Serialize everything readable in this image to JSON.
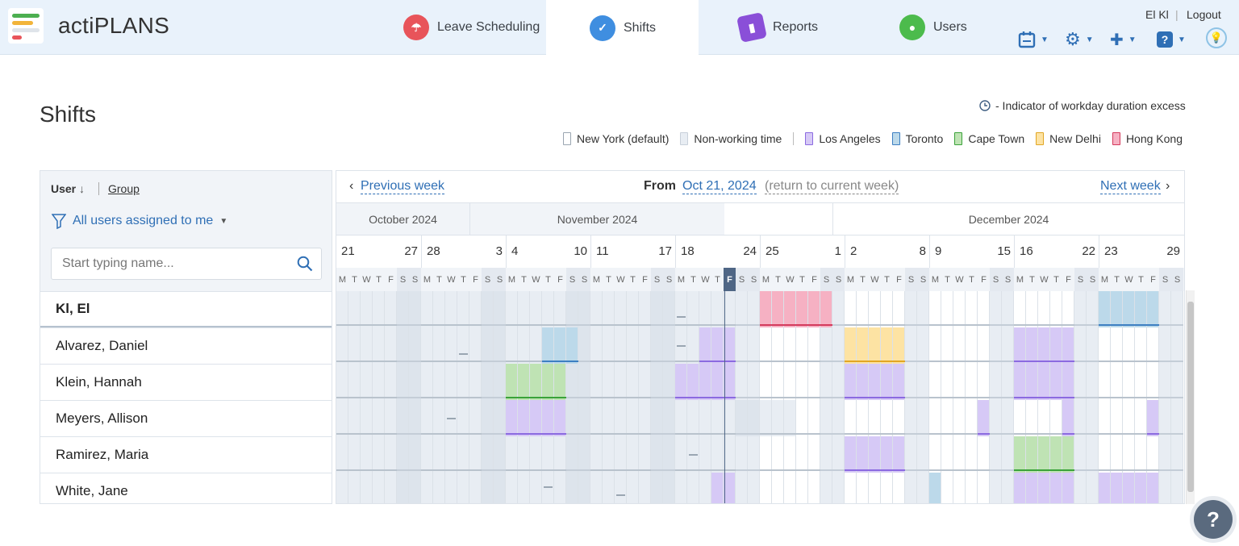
{
  "app": {
    "brand": "actiPLANS"
  },
  "tabs": [
    {
      "label": "Leave Scheduling",
      "icon": "leave-scheduling-icon",
      "color": "#e8545a"
    },
    {
      "label": "Shifts",
      "icon": "shifts-icon",
      "color": "#3f8ee0"
    },
    {
      "label": "Reports",
      "icon": "reports-icon",
      "color": "#8a4fd8"
    },
    {
      "label": "Users",
      "icon": "users-icon",
      "color": "#4cbb4c"
    }
  ],
  "user": {
    "name": "El Kl",
    "logout": "Logout"
  },
  "page": {
    "title": "Shifts",
    "indicator": "- Indicator of workday duration excess"
  },
  "legend": [
    {
      "label": "New York (default)",
      "fill": "#ffffff",
      "border": "#9aa5b1"
    },
    {
      "label": "Non-working time",
      "fill": "#e8edf3",
      "border": "#c8d0da"
    },
    {
      "label": "Los Angeles",
      "fill": "#d6c9f6",
      "border": "#8b6ae0"
    },
    {
      "label": "Toronto",
      "fill": "#bcd9ea",
      "border": "#3d7fc2"
    },
    {
      "label": "Cape Town",
      "fill": "#bfe3b4",
      "border": "#3aa23a"
    },
    {
      "label": "New Delhi",
      "fill": "#fde3a3",
      "border": "#e1a624"
    },
    {
      "label": "Hong Kong",
      "fill": "#f6b1c3",
      "border": "#d43a5c"
    }
  ],
  "sort": {
    "user": "User",
    "group": "Group"
  },
  "filter": {
    "label": "All users assigned to me"
  },
  "search": {
    "placeholder": "Start typing name..."
  },
  "users": [
    "Kl, El",
    "Alvarez, Daniel",
    "Klein, Hannah",
    "Meyers, Allison",
    "Ramirez, Maria",
    "White, Jane"
  ],
  "nav": {
    "prev": "Previous week",
    "from_label": "From",
    "from_date": "Oct 21, 2024",
    "return": "(return to current week)",
    "next": "Next week"
  },
  "months": [
    "October 2024",
    "November 2024",
    "December 2024"
  ],
  "week_starts": [
    "21",
    "28",
    "4",
    "11",
    "18",
    "25",
    "2",
    "9",
    "16",
    "23"
  ],
  "week_ends": [
    "27",
    "3",
    "10",
    "17",
    "24",
    "1",
    "8",
    "15",
    "22",
    "29"
  ],
  "day_letters": [
    "M",
    "T",
    "W",
    "T",
    "F",
    "S",
    "S"
  ],
  "today": "F",
  "help": "?"
}
